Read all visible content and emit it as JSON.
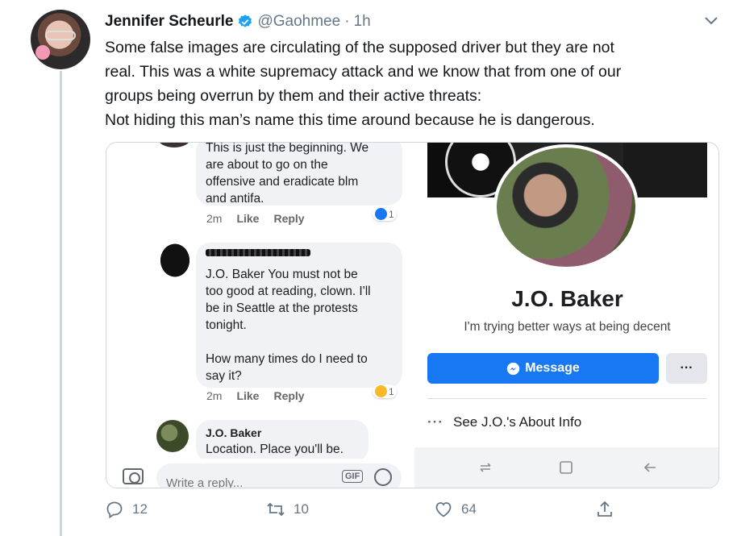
{
  "tweet": {
    "display_name": "Jennifer Scheurle",
    "handle": "@Gaohmee",
    "separator": "·",
    "time": "1h",
    "text_lines": [
      "Some false images are circulating of the supposed driver but they are not",
      "real. This was a white supremacy attack and we know that from one of our",
      "groups being overrun by them and their active threats:",
      "Not hiding this man’s name this time around because he is dangerous."
    ],
    "stats": {
      "replies": "12",
      "retweets": "10",
      "likes": "64"
    }
  },
  "fb_comments": {
    "comment1_lines": [
      "This is just the beginning. We",
      "are about to go on the",
      "offensive and eradicate blm",
      "and antifa."
    ],
    "comment1_time": "2m",
    "comment1_reaction_count": "1",
    "comment2_lines": [
      "J.O. Baker You must not be",
      "too good at reading, clown. I'll",
      "be in Seattle at the protests",
      "tonight."
    ],
    "comment2_lines_b": [
      "How many times do I need to",
      "say it?"
    ],
    "comment2_time": "2m",
    "comment2_reaction_count": "1",
    "comment3_author": "J.O. Baker",
    "comment3_text": "Location. Place you'll be.",
    "like_label": "Like",
    "reply_label": "Reply",
    "reply_placeholder": "Write a reply...",
    "gif_label": "GIF"
  },
  "fb_profile": {
    "name": "J.O. Baker",
    "bio": "I'm trying better ways at being decent",
    "message_button": "Message",
    "more_button": "···",
    "about_dots": "···",
    "about_text": "See J.O.'s About Info"
  },
  "colors": {
    "verified": "#1da1f2",
    "fb_blue": "#1877f2",
    "twitter_gray": "#657786"
  },
  "icons": [
    "verified-badge-icon",
    "chevron-down-icon",
    "camera-icon",
    "gif-icon",
    "emoji-icon",
    "messenger-icon",
    "recent-apps-icon",
    "home-icon",
    "back-icon",
    "reply-icon",
    "retweet-icon",
    "like-icon",
    "share-icon"
  ]
}
